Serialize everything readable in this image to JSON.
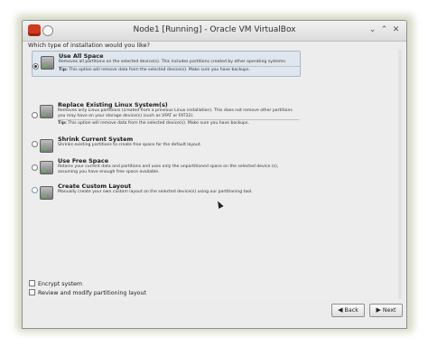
{
  "window": {
    "title": "Node1 [Running] - Oracle VM VirtualBox",
    "controls": {
      "minimize": "⌄",
      "maximize": "⌃",
      "close": "✕"
    }
  },
  "installer": {
    "question": "Which type of installation would you like?",
    "options": [
      {
        "title": "Use All Space",
        "description": "Removes all partitions on the selected device(s).  This includes partitions created by other operating systems.",
        "tip_label": "Tip:",
        "tip": "This option will remove data from the selected device(s).  Make sure you have backups.",
        "selected": true
      },
      {
        "title": "Replace Existing Linux System(s)",
        "description": "Removes only Linux partitions (created from a previous Linux installation).  This does not remove other partitions you may have on your storage device(s) (such as VFAT or FAT32).",
        "tip_label": "Tip:",
        "tip": "This option will remove data from the selected device(s).  Make sure you have backups.",
        "selected": false
      },
      {
        "title": "Shrink Current System",
        "description": "Shrinks existing partitions to create free space for the default layout.",
        "selected": false
      },
      {
        "title": "Use Free Space",
        "description": "Retains your current data and partitions and uses only the unpartitioned space on the selected device (s), assuming you have enough free space available.",
        "selected": false
      },
      {
        "title": "Create Custom Layout",
        "description": "Manually create your own custom layout on the selected device(s) using our partitioning tool.",
        "selected": false
      }
    ],
    "checkboxes": {
      "encrypt": "Encrypt system",
      "review": "Review and modify partitioning layout"
    },
    "buttons": {
      "back": "Back",
      "next": "Next"
    }
  }
}
